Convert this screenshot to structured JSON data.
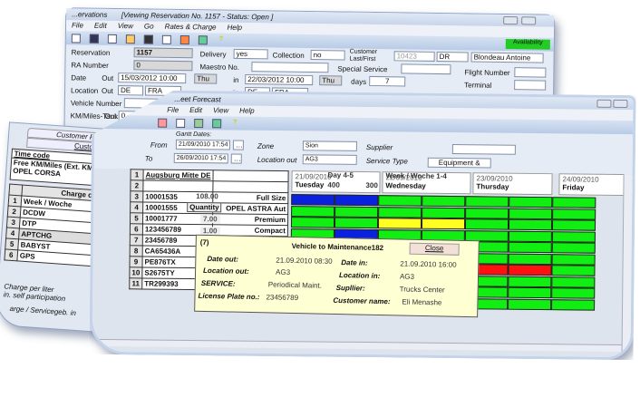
{
  "reservation_window": {
    "title": "...ervations",
    "subtitle": "[Viewing  Reservation  No. 1157  - Status: Open ]",
    "menu": [
      "File",
      "Edit",
      "View",
      "Go",
      "Rates & Charge",
      "Help"
    ],
    "availability_label": "Availability",
    "fields": {
      "reservation_label": "Reservation",
      "reservation_value": "1157",
      "ra_number_label": "RA Number",
      "ra_number_value": "0",
      "delivery_label": "Delivery",
      "delivery_value": "yes",
      "collection_label": "Collection",
      "collection_value": "no",
      "maestro_label": "Maestro No.",
      "customer_label": "Customer Last/First",
      "customer_id": "10423",
      "customer_title": "DR",
      "customer_name": "Blondeau Antoine",
      "special_service_label": "Special Service",
      "flight_number_label": "Flight Number",
      "terminal_label": "Terminal",
      "date_label": "Date",
      "out_label": "Out",
      "date_out": "15/03/2012 10:00",
      "day_out": "Thu",
      "in_label": "in",
      "date_in": "22/03/2012 10:00",
      "day_in": "Thu",
      "days_label": "days",
      "days_value": "7",
      "location_label": "Location",
      "loc_country_out": "DE",
      "loc_city_out": "FRA",
      "loc_country_in": "DE",
      "loc_city_in": "FRA",
      "vehicle_number_label": "Vehicle Number",
      "km_tank_label": "KM/Miles-Tank",
      "km_out_label": "Out",
      "km_out_value": "0"
    }
  },
  "customer_panel": {
    "tab_preference": "Customer Preference",
    "tab_customer": "Customer",
    "time_code_header": "Time code",
    "time_code_rows": [
      "Free KM/Miles (Ext. KM C",
      "OPEL CORSA"
    ],
    "charge_code_header": "Charge code",
    "charge_codes": [
      {
        "n": "1",
        "code": "Week / Woche"
      },
      {
        "n": "2",
        "code": "DCDW"
      },
      {
        "n": "3",
        "code": "DTP"
      },
      {
        "n": "4",
        "code": "APTCHG"
      },
      {
        "n": "5",
        "code": "BABYST"
      },
      {
        "n": "6",
        "code": "GPS"
      }
    ],
    "footer_rows": [
      "Charge per liter",
      "in. self participation",
      "arge / Servicegeb. in"
    ]
  },
  "fleet_window": {
    "title": "...eet Forecast",
    "menu": [
      "File",
      "Edit",
      "View",
      "Help"
    ],
    "filters": {
      "gantt_dates_label": "Gantt Dates:",
      "from_label": "From",
      "from_value": "21/09/2010 17:54",
      "to_label": "To",
      "to_value": "26/09/2010 17:54",
      "zone_label": "Zone",
      "zone_value": "Sion",
      "location_out_label": "Location out",
      "location_out_value": "AG3",
      "supplier_label": "Supplier",
      "supplier_value": "",
      "service_type_label": "Service Type",
      "service_type_value": "Equipment &"
    },
    "vehicle_rows": [
      {
        "n": "1",
        "plate": "Augsburg Mitte DE",
        "desc": ""
      },
      {
        "n": "2",
        "plate": "",
        "desc": ""
      },
      {
        "n": "3",
        "plate": "10001535",
        "desc": "Full Size"
      },
      {
        "n": "4",
        "plate": "10001555",
        "desc": "OPEL ASTRA Aut"
      },
      {
        "n": "5",
        "plate": "10001777",
        "desc": "Premium"
      },
      {
        "n": "6",
        "plate": "123456789",
        "desc": "Compact"
      },
      {
        "n": "7",
        "plate": "23456789",
        "desc": "Compact"
      },
      {
        "n": "8",
        "plate": "CA65436A",
        "desc": "Full"
      },
      {
        "n": "9",
        "plate": "PE876TX",
        "desc": ""
      },
      {
        "n": "10",
        "plate": "S2675TY",
        "desc": ""
      },
      {
        "n": "11",
        "plate": "TR299393",
        "desc": "OP"
      }
    ],
    "quantity_label": "Quantity",
    "quantities": [
      "7.00",
      "1.00",
      "1.00",
      "7.00",
      "7.00",
      "1.00",
      "7.00"
    ],
    "price": "108.00",
    "day_headers": [
      {
        "date": "21/09/2010",
        "day": "Tuesday"
      },
      {
        "date": "22/09/2010",
        "day": "Wednesday"
      },
      {
        "date": "23/09/2010",
        "day": "Thursday"
      },
      {
        "date": "24/09/2010",
        "day": "Friday"
      }
    ],
    "overlay_text": [
      "Day 4-5",
      "Week / Woche 1-4",
      "400",
      "300"
    ],
    "status_colors": {
      "g": "#11ee11",
      "b": "#0a22dd",
      "y": "#ffff22",
      "r": "#ff1111"
    },
    "gantt": [
      [
        "b",
        "b",
        "g",
        "g",
        "g",
        "g",
        "g"
      ],
      [
        "g",
        "g",
        "g",
        "g",
        "g",
        "g",
        "g"
      ],
      [
        "g",
        "g",
        "y",
        "y",
        "g",
        "g",
        "g"
      ],
      [
        "g",
        "b",
        "g",
        "g",
        "g",
        "g",
        "g"
      ],
      [
        "g",
        "b",
        "g",
        "g",
        "g",
        "g",
        "g"
      ],
      [
        "g",
        "g",
        "g",
        "g",
        "g",
        "g",
        "g"
      ],
      [
        "g",
        "g",
        "g",
        "g",
        "r",
        "r",
        "g"
      ],
      [
        "g",
        "g",
        "g",
        "g",
        "g",
        "g",
        "g"
      ],
      [
        "g",
        "g",
        "g",
        "g",
        "g",
        "g",
        "g"
      ],
      [
        "g",
        "g",
        "g",
        "g",
        "g",
        "g",
        "g"
      ]
    ],
    "popup": {
      "tag": "(7)",
      "title": "Vehicle to Maintenance182",
      "close_label": "Close",
      "date_out_label": "Date out:",
      "date_out": "21.09.2010 08:30",
      "location_out_label": "Location out:",
      "location_out": "AG3",
      "service_label": "SERVICE:",
      "service": "Periodical Maint.",
      "plate_label": "License Plate no.:",
      "plate": "23456789",
      "date_in_label": "Date in:",
      "date_in": "21.09.2010 16:00",
      "location_in_label": "Location in:",
      "location_in": "AG3",
      "supplier_label": "Supllier:",
      "supplier": "Trucks Center",
      "customer_label": "Customer name:",
      "customer": "Eli Menashe"
    }
  }
}
